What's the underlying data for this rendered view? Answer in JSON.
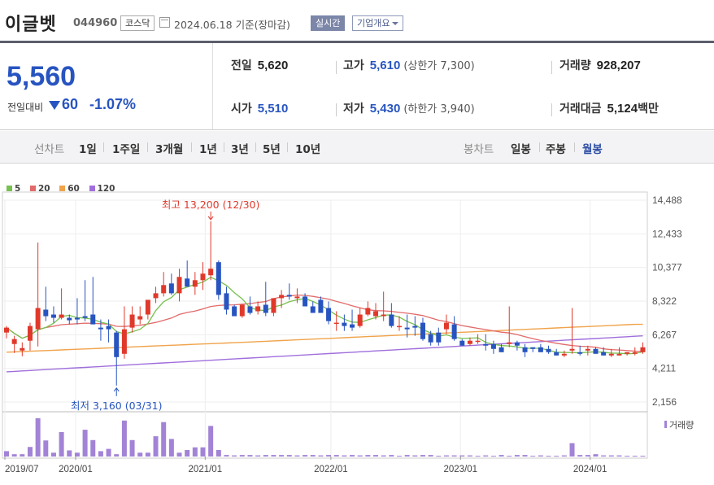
{
  "header": {
    "name": "이글벳",
    "code": "044960",
    "market": "코스닥",
    "date": "2024.06.18",
    "basis": "기준(장마감)",
    "realtime": "실시간",
    "corp_info": "기업개요"
  },
  "summary": {
    "current": "5,560",
    "change_label": "전일대비",
    "change": "60",
    "change_pct": "-1.07%",
    "prev_close_label": "전일",
    "prev_close": "5,620",
    "high_label": "고가",
    "high": "5,610",
    "upper_limit": "(상한가 7,300)",
    "volume_label": "거래량",
    "volume": "928,207",
    "open_label": "시가",
    "open": "5,510",
    "low_label": "저가",
    "low": "5,430",
    "lower_limit": "(하한가 3,940)",
    "amount_label": "거래대금",
    "amount": "5,124",
    "amount_unit": "백만"
  },
  "period_bar": {
    "line_label": "선차트",
    "line_periods": [
      "1일",
      "1주일",
      "3개월",
      "1년",
      "3년",
      "5년",
      "10년"
    ],
    "candle_label": "봉차트",
    "candle_periods": [
      "일봉",
      "주봉",
      "월봉"
    ],
    "selected": "월봉"
  },
  "colors": {
    "up": "#e0392b",
    "down": "#2754c0",
    "ma5": "#77c14f",
    "ma20": "#e26a6a",
    "ma60": "#f0a34a",
    "ma120": "#a06fdc",
    "volume": "#a283d6"
  },
  "chart_data": {
    "type": "candlestick",
    "legend": [
      "5",
      "20",
      "60",
      "120"
    ],
    "y_ticks": [
      "14,488",
      "12,433",
      "10,377",
      "8,322",
      "6,267",
      "4,211",
      "2,156"
    ],
    "ylim": [
      2156,
      14488
    ],
    "x_ticks": [
      "2019/07",
      "2020/01",
      "2021/01",
      "2022/01",
      "2023/01",
      "2024/01"
    ],
    "volume_label": "거래량",
    "high_annotation": "최고 13,200 (12/30)",
    "low_annotation": "최저 3,160 (03/31)",
    "candles": [
      [
        6400,
        6800,
        6050,
        6700
      ],
      [
        5700,
        6200,
        5150,
        6000
      ],
      [
        5300,
        5800,
        4950,
        5450
      ],
      [
        5900,
        7000,
        5300,
        6800
      ],
      [
        6600,
        11900,
        5550,
        7900
      ],
      [
        7800,
        9200,
        7100,
        7400
      ],
      [
        7500,
        8000,
        7000,
        7300
      ],
      [
        7300,
        9100,
        7200,
        7500
      ],
      [
        7300,
        7500,
        6900,
        7150
      ],
      [
        7300,
        8500,
        6900,
        7200
      ],
      [
        7400,
        9600,
        7100,
        7300
      ],
      [
        7500,
        9800,
        6900,
        6900
      ],
      [
        6700,
        7200,
        5900,
        6600
      ],
      [
        6800,
        7200,
        5800,
        6600
      ],
      [
        6400,
        6500,
        3160,
        4900
      ],
      [
        5100,
        8000,
        4800,
        6600
      ],
      [
        6700,
        8000,
        6400,
        7500
      ],
      [
        7200,
        8000,
        6900,
        7400
      ],
      [
        7500,
        8200,
        7200,
        8400
      ],
      [
        8500,
        9200,
        8200,
        8800
      ],
      [
        8800,
        10100,
        8600,
        9300
      ],
      [
        9400,
        10000,
        8700,
        8800
      ],
      [
        8800,
        10300,
        8300,
        9800
      ],
      [
        9700,
        10800,
        9300,
        9200
      ],
      [
        9200,
        10100,
        8700,
        9600
      ],
      [
        9600,
        10700,
        9000,
        10000
      ],
      [
        9900,
        13200,
        9600,
        10300
      ],
      [
        10700,
        10800,
        8400,
        8700
      ],
      [
        8800,
        9200,
        7500,
        7800
      ],
      [
        8000,
        8100,
        7500,
        7400
      ],
      [
        7400,
        8100,
        7300,
        8100
      ],
      [
        8000,
        8600,
        7500,
        7600
      ],
      [
        7700,
        8300,
        7500,
        8000
      ],
      [
        8100,
        9500,
        7400,
        7600
      ],
      [
        7600,
        8200,
        7400,
        8500
      ],
      [
        8500,
        9000,
        7900,
        8700
      ],
      [
        8700,
        9400,
        8400,
        8600
      ],
      [
        8500,
        9100,
        8200,
        8600
      ],
      [
        8600,
        8800,
        8000,
        8000
      ],
      [
        8000,
        8300,
        7600,
        7600
      ],
      [
        8400,
        8600,
        7600,
        7600
      ],
      [
        7900,
        8300,
        6900,
        7100
      ],
      [
        7000,
        7700,
        6500,
        7000
      ],
      [
        7000,
        7500,
        6500,
        6800
      ],
      [
        6900,
        7800,
        6500,
        6700
      ],
      [
        6800,
        7900,
        6700,
        7500
      ],
      [
        7500,
        8300,
        7400,
        7900
      ],
      [
        7400,
        8200,
        7200,
        7700
      ],
      [
        7400,
        8900,
        7100,
        7500
      ],
      [
        7500,
        8200,
        6700,
        6800
      ],
      [
        6800,
        7400,
        6500,
        6800
      ],
      [
        6700,
        7500,
        6100,
        6600
      ],
      [
        6800,
        7400,
        6200,
        6700
      ],
      [
        7000,
        7300,
        5900,
        6000
      ],
      [
        6300,
        6500,
        5600,
        5800
      ],
      [
        6400,
        6700,
        5600,
        5800
      ],
      [
        6600,
        7500,
        6300,
        7000
      ],
      [
        6900,
        7400,
        5900,
        6000
      ],
      [
        5900,
        6000,
        5600,
        5600
      ],
      [
        5700,
        6100,
        5600,
        5900
      ],
      [
        5900,
        6300,
        5700,
        5900
      ],
      [
        5700,
        6300,
        5300,
        5600
      ],
      [
        5700,
        5900,
        5100,
        5400
      ],
      [
        5500,
        5700,
        5200,
        5200
      ],
      [
        5700,
        8000,
        5500,
        5800
      ],
      [
        5800,
        5900,
        5300,
        5600
      ],
      [
        5500,
        5700,
        4900,
        5200
      ],
      [
        5500,
        5500,
        5200,
        5400
      ],
      [
        5500,
        5700,
        5300,
        5200
      ],
      [
        5400,
        5600,
        5100,
        5200
      ],
      [
        5200,
        5400,
        5000,
        5000
      ],
      [
        5000,
        5300,
        4900,
        5100
      ],
      [
        5300,
        7900,
        5100,
        5400
      ],
      [
        5200,
        5600,
        5000,
        5100
      ],
      [
        5300,
        5600,
        5000,
        5400
      ],
      [
        5400,
        5500,
        5200,
        5100
      ],
      [
        5200,
        5500,
        5000,
        5000
      ],
      [
        5000,
        5400,
        4900,
        5100
      ],
      [
        5000,
        5500,
        5000,
        5100
      ],
      [
        5100,
        5200,
        5000,
        5200
      ],
      [
        5100,
        5500,
        5000,
        5200
      ],
      [
        5200,
        5800,
        5100,
        5500
      ]
    ],
    "volumes": [
      14,
      6,
      6,
      25,
      100,
      42,
      10,
      64,
      16,
      10,
      70,
      43,
      14,
      20,
      6,
      94,
      43,
      10,
      10,
      53,
      90,
      46,
      10,
      17,
      24,
      24,
      80,
      17,
      4,
      3,
      4,
      4,
      3,
      4,
      4,
      4,
      4,
      3,
      4,
      4,
      3,
      4,
      4,
      3,
      4,
      3,
      4,
      4,
      3,
      4,
      2,
      4,
      3,
      4,
      4,
      2,
      3,
      3,
      3,
      3,
      2,
      3,
      2,
      4,
      2,
      4,
      4,
      2,
      3,
      2,
      2,
      3,
      35,
      4,
      4,
      6,
      3,
      3,
      3,
      2,
      2,
      2
    ]
  }
}
